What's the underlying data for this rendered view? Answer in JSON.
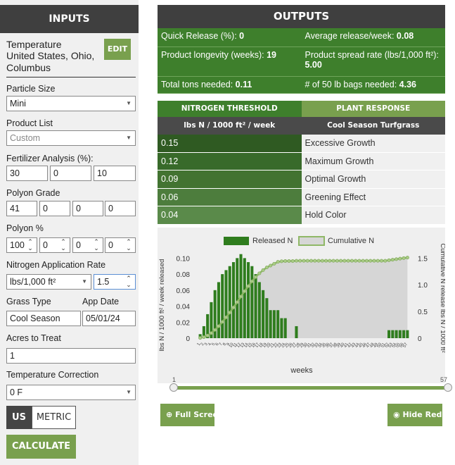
{
  "inputs": {
    "header": "INPUTS",
    "temperature": {
      "label": "Temperature",
      "location": "United States, Ohio, Columbus",
      "edit_label": "EDIT"
    },
    "particle_size": {
      "label": "Particle Size",
      "value": "Mini"
    },
    "product_list": {
      "label": "Product List",
      "value": "Custom"
    },
    "fertilizer_analysis": {
      "label": "Fertilizer Analysis (%):",
      "values": [
        "30",
        "0",
        "10"
      ]
    },
    "polyon_grade": {
      "label": "Polyon Grade",
      "values": [
        "41",
        "0",
        "0",
        "0"
      ]
    },
    "polyon_percent": {
      "label": "Polyon %",
      "values": [
        "100",
        "0",
        "0",
        "0"
      ]
    },
    "nitrogen_rate": {
      "label": "Nitrogen Application Rate",
      "unit": "lbs/1,000 ft²",
      "value": "1.5"
    },
    "grass_type": {
      "label": "Grass Type",
      "value": "Cool Season"
    },
    "app_date": {
      "label": "App Date",
      "value": "05/01/24"
    },
    "acres": {
      "label": "Acres to Treat",
      "value": "1"
    },
    "temp_correction": {
      "label": "Temperature Correction",
      "value": "0 F"
    },
    "units": {
      "us": "US",
      "metric": "METRIC"
    },
    "calculate_label": "CALCULATE"
  },
  "outputs": {
    "header": "OUTPUTS",
    "rows": [
      [
        {
          "label": "Quick Release (%): ",
          "value": "0"
        },
        {
          "label": "Average release/week: ",
          "value": "0.08"
        }
      ],
      [
        {
          "label": "Product longevity (weeks): ",
          "value": "19"
        },
        {
          "label": "Product spread rate (lbs/1,000 ft²): ",
          "value": "5.00"
        }
      ],
      [
        {
          "label": "Total tons needed: ",
          "value": "0.11"
        },
        {
          "label": "# of 50 lb bags needed: ",
          "value": "4.36"
        }
      ]
    ],
    "tabs": [
      "NITROGEN THRESHOLD",
      "PLANT RESPONSE"
    ],
    "col_headers": [
      "lbs N / 1000 ft² / week",
      "Cool Season Turfgrass"
    ],
    "thresholds": [
      {
        "value": "0.15",
        "response": "Excessive Growth",
        "color": "#2f5a22"
      },
      {
        "value": "0.12",
        "response": "Maximum Growth",
        "color": "#386a2a"
      },
      {
        "value": "0.09",
        "response": "Optimal Growth",
        "color": "#427331"
      },
      {
        "value": "0.06",
        "response": "Greening Effect",
        "color": "#4d7d3d"
      },
      {
        "value": "0.04",
        "response": "Hold Color",
        "color": "#5a8a4a"
      }
    ],
    "full_screen_label": "Full Screen",
    "hide_red_label": "Hide Red Lin",
    "slider": {
      "min": "1",
      "max": "57"
    }
  },
  "colors": {
    "accent": "#79a04e",
    "dark_green": "#3e7f2c",
    "bar_green": "#2f7d1e",
    "header_dark": "#3f3f3f"
  },
  "chart_data": {
    "type": "bar",
    "xlabel": "weeks",
    "ylabel_left": "lbs N / 1000 ft² / week released",
    "ylabel_right": "Cumulative N release lbs N / 1000 ft²",
    "left_ticks": [
      "0",
      "0.02",
      "0.04",
      "0.06",
      "0.08",
      "0.10"
    ],
    "right_ticks": [
      "0",
      "0.5",
      "1.0",
      "1.5"
    ],
    "ylim_left": [
      0,
      0.11
    ],
    "ylim_right": [
      0,
      1.65
    ],
    "weeks": 57,
    "series": [
      {
        "name": "Released N",
        "type": "bar",
        "values": [
          0.005,
          0.015,
          0.03,
          0.045,
          0.06,
          0.07,
          0.08,
          0.085,
          0.09,
          0.095,
          0.1,
          0.105,
          0.1,
          0.095,
          0.09,
          0.08,
          0.07,
          0.06,
          0.05,
          0.035,
          0.035,
          0.035,
          0.025,
          0.025,
          0,
          0,
          0.015,
          0,
          0,
          0,
          0,
          0,
          0,
          0,
          0,
          0,
          0,
          0,
          0,
          0,
          0,
          0,
          0,
          0,
          0,
          0,
          0,
          0,
          0,
          0,
          0,
          0.01,
          0.01,
          0.01,
          0.01,
          0.01,
          0.01
        ]
      },
      {
        "name": "Cumulative N",
        "type": "area",
        "values": [
          0.005,
          0.02,
          0.05,
          0.095,
          0.155,
          0.225,
          0.305,
          0.39,
          0.48,
          0.575,
          0.675,
          0.78,
          0.88,
          0.975,
          1.065,
          1.145,
          1.215,
          1.275,
          1.325,
          1.36,
          1.395,
          1.43,
          1.44,
          1.445,
          1.445,
          1.445,
          1.45,
          1.45,
          1.45,
          1.45,
          1.45,
          1.45,
          1.45,
          1.45,
          1.45,
          1.45,
          1.45,
          1.45,
          1.45,
          1.45,
          1.45,
          1.45,
          1.45,
          1.45,
          1.45,
          1.45,
          1.45,
          1.45,
          1.45,
          1.45,
          1.45,
          1.46,
          1.47,
          1.48,
          1.49,
          1.5,
          1.51
        ]
      }
    ]
  }
}
